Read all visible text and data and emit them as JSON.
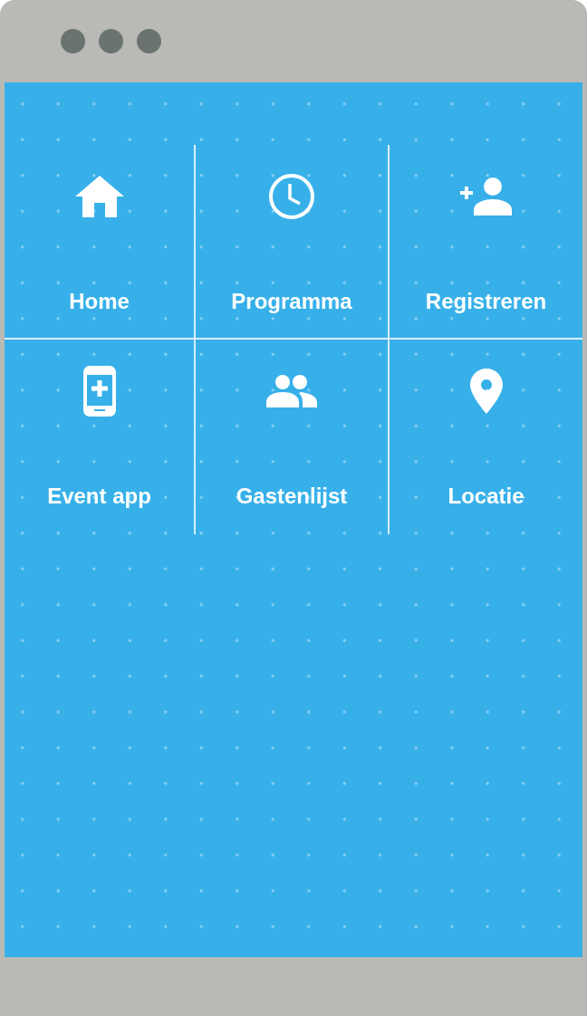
{
  "menu": [
    {
      "label": "Home",
      "kind": "home"
    },
    {
      "label": "Programma",
      "kind": "clock"
    },
    {
      "label": "Registreren",
      "kind": "add-person"
    },
    {
      "label": "Event app",
      "kind": "phone-plus"
    },
    {
      "label": "Gastenlijst",
      "kind": "group"
    },
    {
      "label": "Locatie",
      "kind": "pin"
    }
  ]
}
